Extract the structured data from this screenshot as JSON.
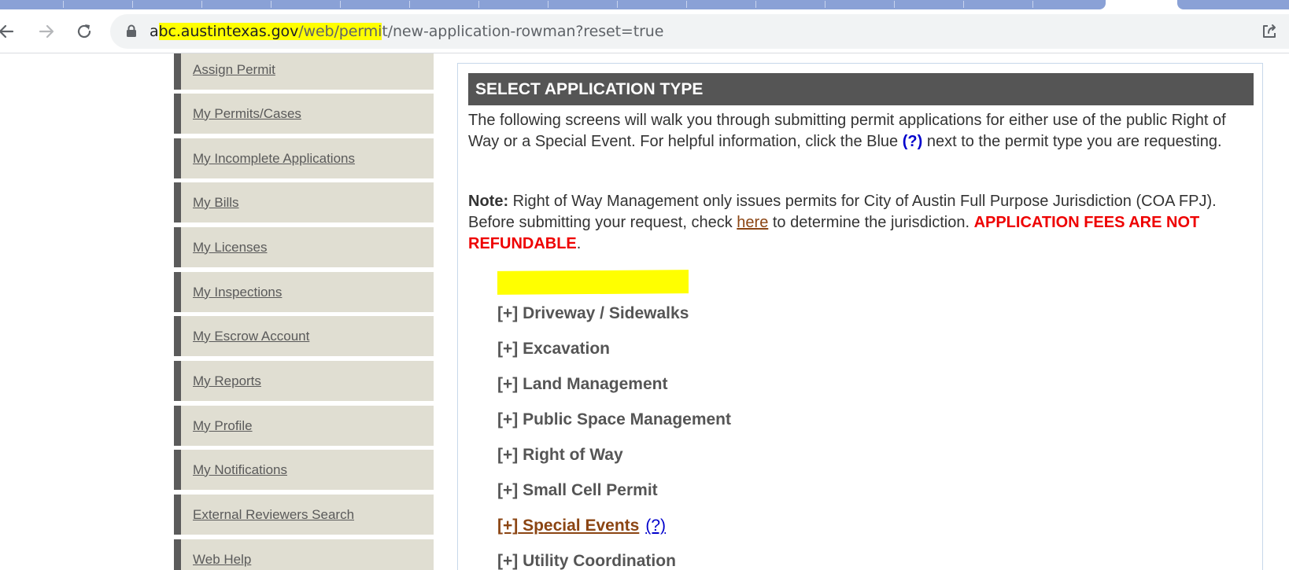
{
  "browser": {
    "url_host": "abc.austintexas.gov",
    "url_path": "/web/permit/new-application-rowman?reset=true",
    "url_prefix": "a",
    "url_host_rest": "bc.austintexas.gov",
    "url_hl_path": "/web/permi",
    "url_tail": "t/new-application-rowman?reset=true",
    "icons": {
      "back": "back-arrow-icon",
      "forward": "forward-arrow-icon",
      "reload": "reload-icon",
      "lock": "lock-icon",
      "share": "share-icon"
    }
  },
  "sidebar": {
    "items": [
      {
        "label": "Assign Permit"
      },
      {
        "label": "My Permits/Cases"
      },
      {
        "label": "My Incomplete Applications"
      },
      {
        "label": "My Bills"
      },
      {
        "label": "My Licenses"
      },
      {
        "label": "My Inspections"
      },
      {
        "label": "My Escrow Account"
      },
      {
        "label": "My Reports"
      },
      {
        "label": "My Profile"
      },
      {
        "label": "My Notifications"
      },
      {
        "label": "External Reviewers Search"
      },
      {
        "label": "Web Help"
      }
    ]
  },
  "main": {
    "title": "SELECT APPLICATION TYPE",
    "intro_before": "The following screens will walk you through submitting permit applications for either use of the public Right of Way or a Special Event. For helpful information, click the Blue ",
    "intro_q": "(?)",
    "intro_after": " next to the permit type you are requesting.",
    "note_label": "Note:",
    "note_text": " Right of Way Management only issues permits for City of Austin Full Purpose Jurisdiction (COA FPJ). Before submitting your request, check ",
    "note_link": "here",
    "note_text2": " to determine the jurisdiction. ",
    "note_warning": "APPLICATION FEES ARE NOT REFUNDABLE",
    "note_end": ".",
    "application_types": [
      {
        "prefix": "[+]",
        "label": "Driveway / Sidewalks"
      },
      {
        "prefix": "[+]",
        "label": "Excavation"
      },
      {
        "prefix": "[+]",
        "label": "Land Management"
      },
      {
        "prefix": "[+]",
        "label": "Public Space Management"
      },
      {
        "prefix": "[+]",
        "label": "Right of Way"
      },
      {
        "prefix": "[+]",
        "label": "Small Cell Permit"
      },
      {
        "prefix": "[+]",
        "label": " Special Events",
        "help": "(?)"
      },
      {
        "prefix": "[+]",
        "label": "Utility Coordination"
      }
    ]
  },
  "colors": {
    "title_bar": "#555555",
    "sidebar_bg": "#e0ded2",
    "sidebar_accent": "#5b5b5b",
    "warning_red": "#ee0000",
    "help_blue": "#0000cc",
    "link_brown": "#8b4513",
    "highlight": "#ffff00"
  }
}
